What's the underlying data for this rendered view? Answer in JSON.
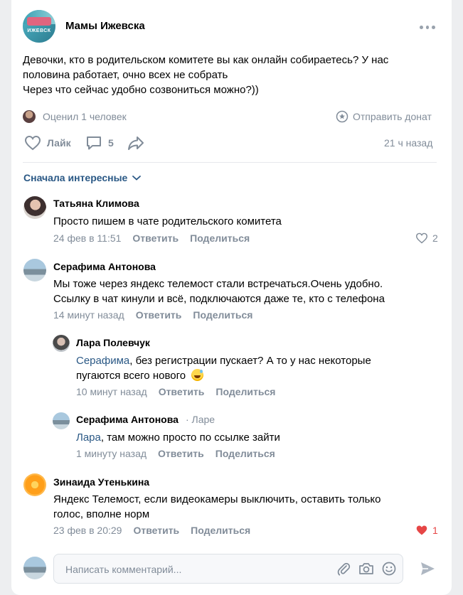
{
  "post": {
    "group_name": "Мамы Ижевска",
    "avatar_text": "ИЖЕВСК",
    "text_lines": [
      "Девочки, кто в родительском комитете вы как онлайн собираетесь? У нас",
      "половина работает, очно всех не собрать",
      "Через что сейчас удобно созвониться можно?))"
    ],
    "rated_by": "Оценил 1 человек",
    "donate_label": "Отправить донат",
    "like_label": "Лайк",
    "comments_count": "5",
    "time": "21 ч назад"
  },
  "sort_label": "Сначала интересные",
  "comments": [
    {
      "name": "Татьяна Климова",
      "lines": [
        "Просто пишем в чате родительского комитета"
      ],
      "time": "24 фев в 11:51",
      "reply": "Ответить",
      "share": "Поделиться",
      "likes": "2"
    },
    {
      "name": "Серафима Антонова",
      "lines": [
        "Мы тоже через яндекс телемост стали встречаться.Очень удобно.",
        "Ссылку в чат кинули и всё, подключаются даже те, кто с телефона"
      ],
      "time": "14 минут назад",
      "reply": "Ответить",
      "share": "Поделиться"
    },
    {
      "name": "Лара Полевчук",
      "mention": "Серафима",
      "line1_rest": ", без регистрации пускает? А то у нас некоторые",
      "line2": "пугаются всего нового",
      "time": "10 минут назад",
      "reply": "Ответить",
      "share": "Поделиться"
    },
    {
      "name": "Серафима Антонова",
      "to": "· Ларе",
      "mention": "Лара",
      "line1_rest": ", там можно просто по ссылке зайти",
      "time": "1 минуту назад",
      "reply": "Ответить",
      "share": "Поделиться"
    },
    {
      "name": "Зинаида Утенькина",
      "lines": [
        "Яндекс Телемост, если видеокамеры выключить, оставить только",
        "голос, вполне норм"
      ],
      "time": "23 фев в 20:29",
      "reply": "Ответить",
      "share": "Поделиться",
      "likes": "1"
    }
  ],
  "composer": {
    "placeholder": "Написать комментарий..."
  },
  "colors": {
    "link": "#2a5885",
    "muted": "#818c99",
    "liked": "#e64646",
    "background": "#edeef0"
  }
}
